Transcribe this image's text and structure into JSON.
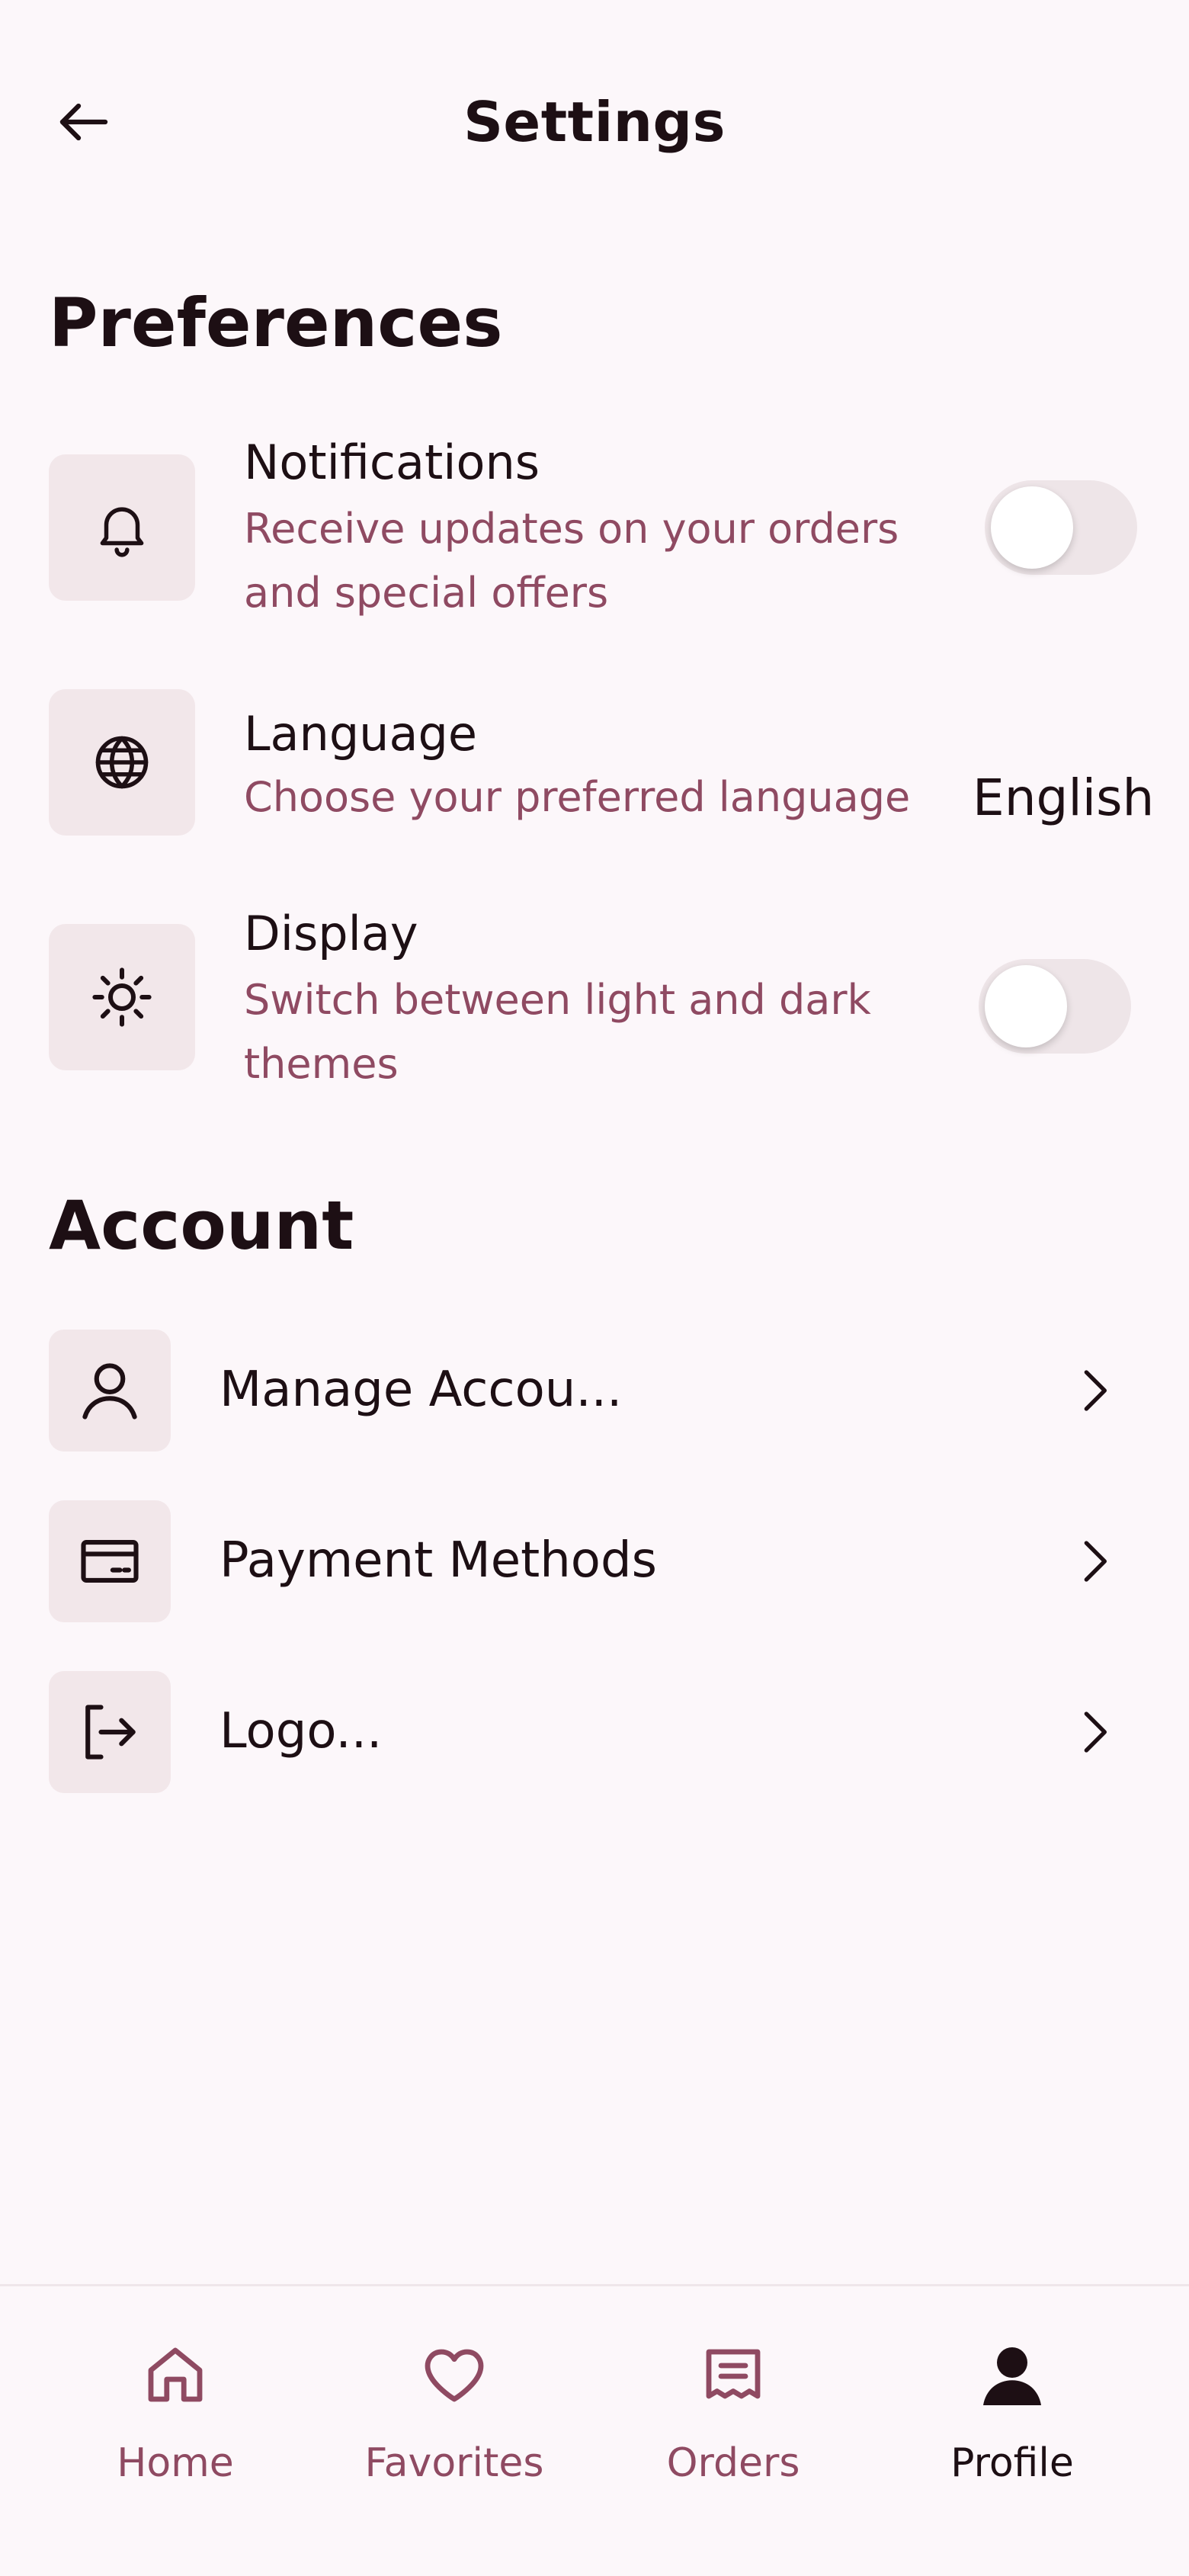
{
  "header": {
    "title": "Settings"
  },
  "preferences": {
    "title": "Preferences",
    "items": [
      {
        "icon": "bell-icon",
        "title": "Notifications",
        "subtitle_line1": "Receive updates on your orders",
        "subtitle_line2": "and special offers",
        "toggle": false
      },
      {
        "icon": "globe-icon",
        "title": "Language",
        "subtitle_line1": "Choose your preferred language",
        "value": "English"
      },
      {
        "icon": "sun-icon",
        "title": "Display",
        "subtitle_line1": "Switch between light and dark",
        "subtitle_line2": "themes",
        "toggle": false
      }
    ]
  },
  "account": {
    "title": "Account",
    "items": [
      {
        "icon": "user-icon",
        "label": "Manage Accou..."
      },
      {
        "icon": "credit-card-icon",
        "label": "Payment Methods"
      },
      {
        "icon": "logout-icon",
        "label": "Logo..."
      }
    ]
  },
  "bottom_nav": {
    "items": [
      {
        "icon": "home-icon",
        "label": "Home",
        "active": false
      },
      {
        "icon": "heart-icon",
        "label": "Favorites",
        "active": false
      },
      {
        "icon": "receipt-icon",
        "label": "Orders",
        "active": false
      },
      {
        "icon": "profile-icon",
        "label": "Profile",
        "active": true
      }
    ]
  },
  "colors": {
    "background": "#fcf7fa",
    "text_primary": "#1d0f14",
    "text_secondary": "#8f4a62",
    "tile": "#f2e7ea",
    "toggle_track": "#eee5e8"
  }
}
